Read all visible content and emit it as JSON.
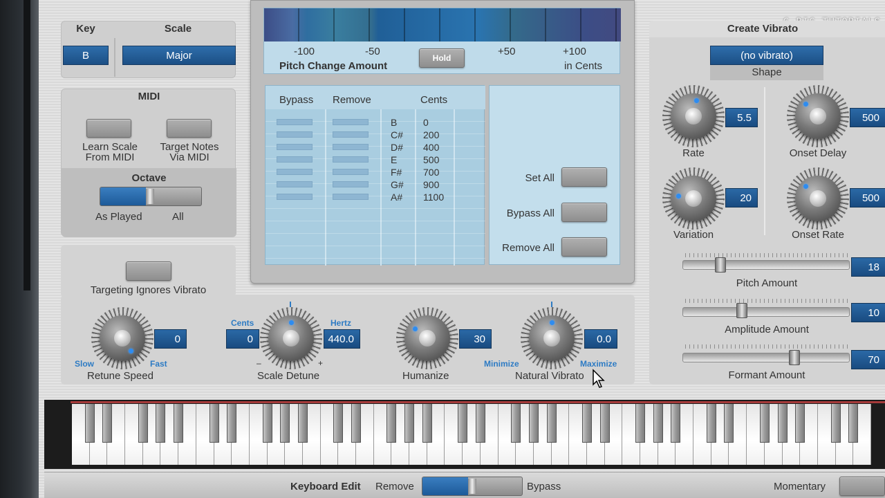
{
  "watermark": "G-BIG TUTORIALS",
  "key_scale": {
    "key_header": "Key",
    "scale_header": "Scale",
    "key_value": "B",
    "scale_value": "Major"
  },
  "midi": {
    "title": "MIDI",
    "learn_scale": "Learn Scale\nFrom MIDI",
    "target_notes": "Target Notes\nVia MIDI",
    "octave_title": "Octave",
    "as_played": "As Played",
    "all": "All"
  },
  "pitch": {
    "ticks": [
      "-100",
      "-50",
      "+50",
      "+100"
    ],
    "label": "Pitch Change Amount",
    "units": "in Cents",
    "hold": "Hold"
  },
  "table": {
    "headers": {
      "bypass": "Bypass",
      "remove": "Remove",
      "cents": "Cents"
    },
    "rows": [
      {
        "note": "B",
        "cents": "0"
      },
      {
        "note": "C#",
        "cents": "200"
      },
      {
        "note": "D#",
        "cents": "400"
      },
      {
        "note": "E",
        "cents": "500"
      },
      {
        "note": "F#",
        "cents": "700"
      },
      {
        "note": "G#",
        "cents": "900"
      },
      {
        "note": "A#",
        "cents": "1100"
      }
    ],
    "set_all": "Set All",
    "bypass_all": "Bypass All",
    "remove_all": "Remove All"
  },
  "targeting": {
    "label": "Targeting Ignores Vibrato"
  },
  "retune": {
    "label": "Retune Speed",
    "value": "0",
    "slow": "Slow",
    "fast": "Fast"
  },
  "detune": {
    "label": "Scale Detune",
    "cents_label": "Cents",
    "hertz_label": "Hertz",
    "cents_value": "0",
    "hertz_value": "440.0",
    "minus": "–",
    "plus": "+"
  },
  "humanize": {
    "label": "Humanize",
    "value": "30"
  },
  "natural_vibrato": {
    "label": "Natural Vibrato",
    "value": "0.0",
    "minimize": "Minimize",
    "maximize": "Maximize"
  },
  "vibrato": {
    "title": "Create Vibrato",
    "shape_value": "(no vibrato)",
    "shape_label": "Shape",
    "rate_label": "Rate",
    "rate_value": "5.5",
    "onset_delay_label": "Onset Delay",
    "onset_delay_value": "500",
    "variation_label": "Variation",
    "variation_value": "20",
    "onset_rate_label": "Onset Rate",
    "onset_rate_value": "500",
    "pitch_amount_label": "Pitch Amount",
    "pitch_amount_value": "18",
    "amplitude_amount_label": "Amplitude Amount",
    "amplitude_amount_value": "10",
    "formant_amount_label": "Formant Amount",
    "formant_amount_value": "70"
  },
  "keyboard_edit": {
    "title": "Keyboard Edit",
    "remove": "Remove",
    "bypass": "Bypass",
    "momentary": "Momentary"
  },
  "colors": {
    "accent_blue": "#1f5a94",
    "knob_dot": "#2e8cf0",
    "lcd": "#9fc6dd",
    "piano_frame": "#1c1c1c"
  }
}
